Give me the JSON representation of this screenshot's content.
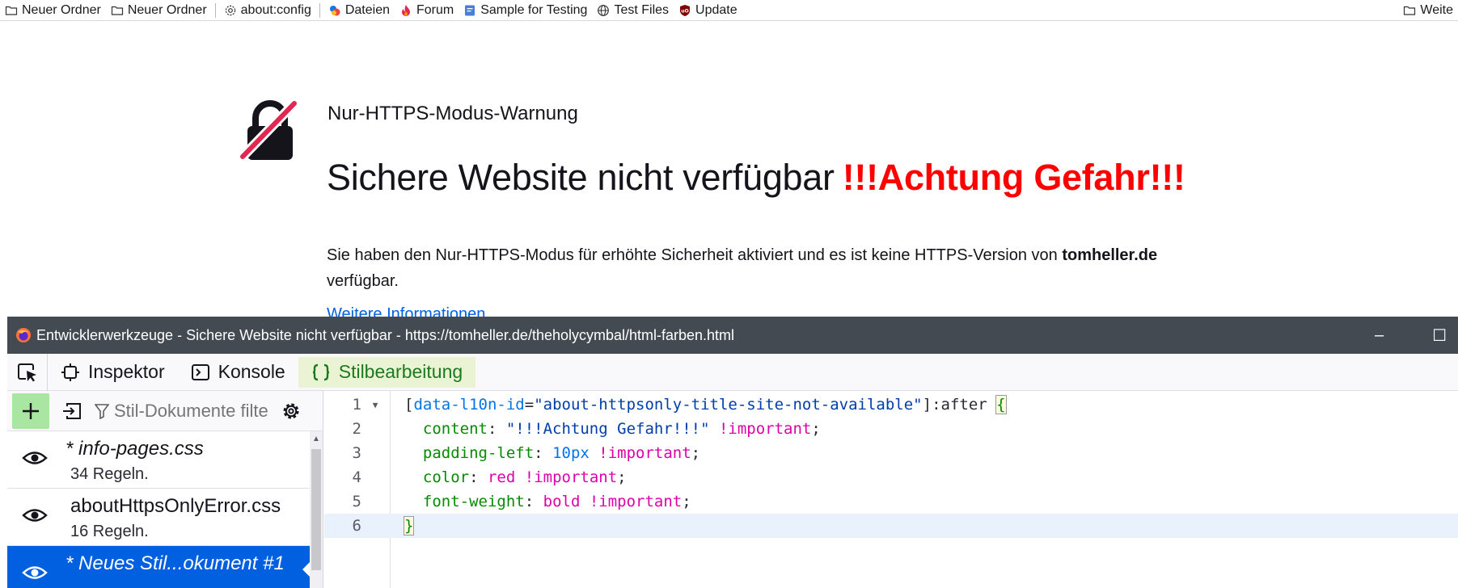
{
  "bookmarks": {
    "items": [
      {
        "label": "Neuer Ordner",
        "icon": "folder-icon"
      },
      {
        "label": "Neuer Ordner",
        "icon": "folder-icon"
      },
      {
        "label": "about:config",
        "icon": "gear-icon"
      },
      {
        "label": "Dateien",
        "icon": "dateien-icon"
      },
      {
        "label": "Forum",
        "icon": "flame-icon"
      },
      {
        "label": "Sample for Testing",
        "icon": "doc-icon"
      },
      {
        "label": "Test Files",
        "icon": "globe-icon"
      },
      {
        "label": "Update",
        "icon": "ublock-icon"
      }
    ],
    "overflow_label": "Weite"
  },
  "page": {
    "subtitle": "Nur-HTTPS-Modus-Warnung",
    "title": "Sichere Website nicht verfügbar",
    "title_after": "!!!Achtung Gefahr!!!",
    "desc_before": "Sie haben den Nur-HTTPS-Modus für erhöhte Sicherheit aktiviert und es ist keine HTTPS-Version von ",
    "desc_host": "tomheller.de",
    "desc_after": " verfügbar.",
    "link": "Weitere Informationen",
    "colors": {
      "after_text": "#ff0000",
      "link": "#0061e0"
    }
  },
  "devtools": {
    "window_title": "Entwicklerwerkzeuge - Sichere Website nicht verfügbar - https://tomheller.de/theholycymbal/html-farben.html",
    "tabs": [
      {
        "label": "Inspektor",
        "icon": "inspector-icon",
        "active": false
      },
      {
        "label": "Konsole",
        "icon": "console-icon",
        "active": false
      },
      {
        "label": "Stilbearbeitung",
        "icon": "braces-icon",
        "active": true
      }
    ],
    "filter_placeholder": "Stil-Dokumente filtern",
    "stylesheets": [
      {
        "name": "* info-pages.css",
        "rules": "34 Regeln.",
        "italic": true,
        "selected": false
      },
      {
        "name": "aboutHttpsOnlyError.css",
        "rules": "16 Regeln.",
        "italic": false,
        "selected": false
      },
      {
        "name": "* Neues Stil...okument #1",
        "rules": "",
        "italic": true,
        "selected": true
      }
    ],
    "editor": {
      "line_numbers": [
        "1",
        "2",
        "3",
        "4",
        "5",
        "6"
      ],
      "selector_attr": "data-l10n-id",
      "selector_value": "\"about-httpsonly-title-site-not-available\"",
      "selector_pseudo": ":after",
      "declarations": [
        {
          "prop": "content",
          "value": "\"!!!Achtung Gefahr!!!\"",
          "important": "!important"
        },
        {
          "prop": "padding-left",
          "value": "10px",
          "important": "!important"
        },
        {
          "prop": "color",
          "value": "red",
          "important": "!important"
        },
        {
          "prop": "font-weight",
          "value": "bold",
          "important": "!important"
        }
      ]
    }
  }
}
